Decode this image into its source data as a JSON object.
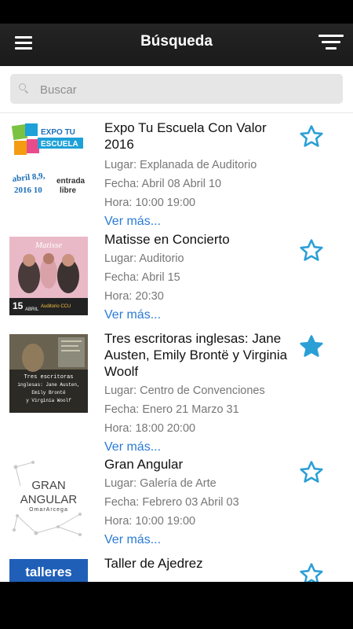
{
  "header": {
    "title": "Búsqueda",
    "menu_icon": "hamburger-menu-icon",
    "filter_icon": "filter-icon"
  },
  "search": {
    "placeholder": "Buscar",
    "value": ""
  },
  "colors": {
    "link": "#2a7bd6",
    "star": "#2a9fd6",
    "header_bg": "#222222"
  },
  "events": [
    {
      "title": "Expo Tu Escuela Con Valor 2016",
      "place": "Lugar: Explanada de Auditorio",
      "date": "Fecha: Abril 08 Abril 10",
      "time": "Hora: 10:00 19:00",
      "more": "Ver más...",
      "favorite": false,
      "thumb_text": [
        "EXPO TU ESCUELA",
        "abril 8,9,",
        "2016 10",
        "entrada",
        "libre"
      ]
    },
    {
      "title": "Matisse en Concierto",
      "place": "Lugar: Auditorio",
      "date": "Fecha: Abril 15",
      "time": "Hora: 20:30",
      "more": "Ver más...",
      "favorite": false,
      "thumb_text": [
        "Matisse",
        "15",
        "ABRIL",
        "Auditorio CCU"
      ]
    },
    {
      "title": "Tres escritoras inglesas: Jane Austen, Emily Brontë y Virginia Woolf",
      "place": "Lugar: Centro de Convenciones",
      "date": "Fecha: Enero 21 Marzo 31",
      "time": "Hora: 18:00 20:00",
      "more": "Ver más...",
      "favorite": true,
      "thumb_text": [
        "Tres escritoras",
        "inglesas: Jane Austen,",
        "Emily Brontë",
        "y Virginia Woolf"
      ]
    },
    {
      "title": "Gran Angular",
      "place": "Lugar: Galería de Arte",
      "date": "Fecha: Febrero 03 Abril 03",
      "time": "Hora: 10:00 19:00",
      "more": "Ver más...",
      "favorite": false,
      "thumb_text": [
        "GRAN",
        "ANGULAR",
        "OmarArcega"
      ]
    },
    {
      "title": "Taller de Ajedrez",
      "favorite": false,
      "thumb_text": [
        "talleres"
      ]
    }
  ]
}
